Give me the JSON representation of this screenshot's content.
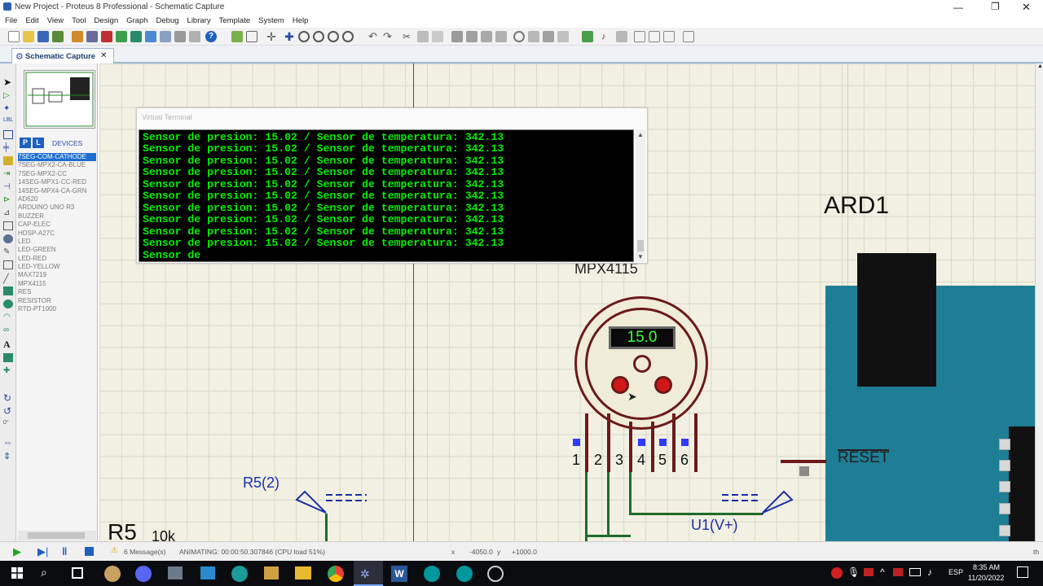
{
  "window": {
    "title": "New Project - Proteus 8 Professional - Schematic Capture"
  },
  "menu": [
    "File",
    "Edit",
    "View",
    "Tool",
    "Design",
    "Graph",
    "Debug",
    "Library",
    "Template",
    "System",
    "Help"
  ],
  "tab": {
    "label": "Schematic Capture",
    "close": "✕"
  },
  "panel": {
    "p_button": "P",
    "l_button": "L",
    "title": "DEVICES"
  },
  "devices": [
    "7SEG-COM-CATHODE",
    "7SEG-MPX2-CA-BLUE",
    "7SEG-MPX2-CC",
    "14SEG-MPX1-CC-RED",
    "14SEG-MPX4-CA-GRN",
    "AD620",
    "ARDUINO UNO R3",
    "BUZZER",
    "CAP-ELEC",
    "HDSP-A27C",
    "LED",
    "LED-GREEN",
    "LED-RED",
    "LED-YELLOW",
    "MAX7219",
    "MPX4115",
    "RES",
    "RESISTOR",
    "RTD-PT1000"
  ],
  "selected_device": "7SEG-COM-CATHODE",
  "terminal": {
    "title": "Virtual Terminal",
    "lines": [
      "Sensor de presion: 15.02 / Sensor de temperatura: 342.13",
      "Sensor de presion: 15.02 / Sensor de temperatura: 342.13",
      "Sensor de presion: 15.02 / Sensor de temperatura: 342.13",
      "Sensor de presion: 15.02 / Sensor de temperatura: 342.13",
      "Sensor de presion: 15.02 / Sensor de temperatura: 342.13",
      "Sensor de presion: 15.02 / Sensor de temperatura: 342.13",
      "Sensor de presion: 15.02 / Sensor de temperatura: 342.13",
      "Sensor de presion: 15.02 / Sensor de temperatura: 342.13",
      "Sensor de presion: 15.02 / Sensor de temperatura: 342.13",
      "Sensor de presion: 15.02 / Sensor de temperatura: 342.13",
      "Sensor de"
    ]
  },
  "schematic": {
    "ard_label": "ARD1",
    "mpx_label": "MPX4115",
    "sensor_display": "15.0",
    "pins": [
      "1",
      "2",
      "3",
      "4",
      "5",
      "6"
    ],
    "reset_label": "RESET",
    "r5_2_label": "R5(2)",
    "u1_label": "U1(V+)",
    "r5_label": "R5",
    "r5_value": "10k"
  },
  "status": {
    "messages": "6 Message(s)",
    "animating": "ANIMATING: 00:00:50.307846 (CPU load 51%)",
    "x_label": "x",
    "x_value": "-4050.0",
    "y_label": "y",
    "y_value": "+1000.0",
    "th": "th"
  },
  "taskbar": {
    "time": "8:35 AM",
    "date": "11/20/2022",
    "lang": "ESP"
  },
  "colors": {
    "terminal_text": "#00f000",
    "arduino_teal": "#1e7e95",
    "sensor_body": "#6b1a1a",
    "wire_green": "#1e6b2a"
  }
}
